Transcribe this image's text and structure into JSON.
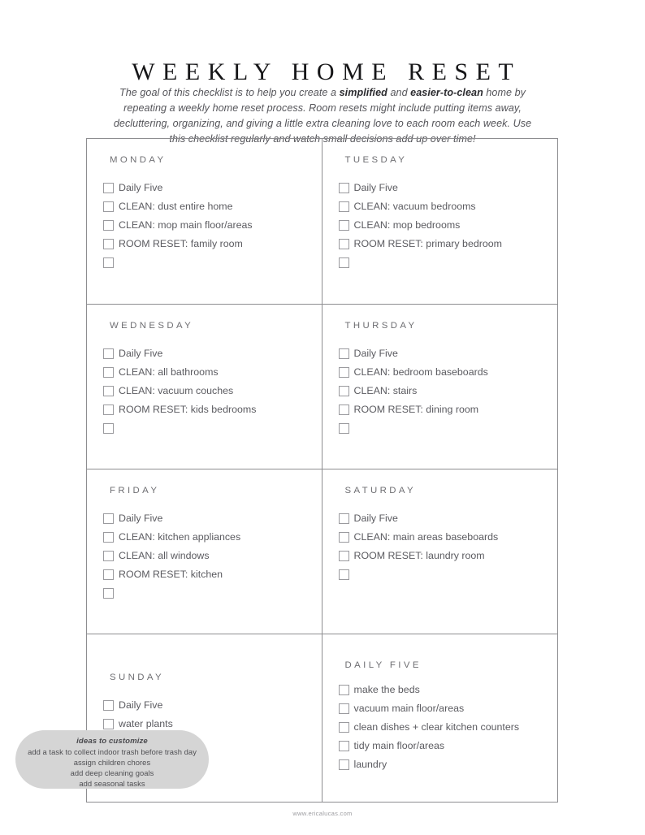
{
  "document": {
    "title": "WEEKLY HOME RESET",
    "intro_part1": "The goal of this checklist is to help you create a ",
    "intro_bold1": "simplified",
    "intro_part2": " and ",
    "intro_bold2": "easier-to-clean",
    "intro_part3": " home by repeating a weekly home reset process. Room resets might include putting items away, decluttering, organizing, and giving a little extra cleaning love to each room each week. Use this checklist regularly and watch small decisions add up over time!",
    "footer": "www.ericalucas.com"
  },
  "colors": {
    "border": "#8d8d90",
    "title_text": "#161618",
    "body_text": "#5b5b60",
    "bubble_bg": "#d5d5d5"
  },
  "sections": [
    {
      "key": "monday",
      "heading": "MONDAY",
      "tasks": [
        "Daily Five",
        "CLEAN: dust entire home",
        "CLEAN: mop main floor/areas",
        "ROOM RESET: family room",
        ""
      ]
    },
    {
      "key": "tuesday",
      "heading": "TUESDAY",
      "tasks": [
        "Daily Five",
        "CLEAN: vacuum bedrooms",
        "CLEAN: mop bedrooms",
        "ROOM RESET: primary bedroom",
        ""
      ]
    },
    {
      "key": "wednesday",
      "heading": "WEDNESDAY",
      "tasks": [
        "Daily Five",
        "CLEAN: all bathrooms",
        "CLEAN: vacuum couches",
        "ROOM RESET: kids bedrooms",
        ""
      ]
    },
    {
      "key": "thursday",
      "heading": "THURSDAY",
      "tasks": [
        "Daily Five",
        "CLEAN: bedroom baseboards",
        "CLEAN: stairs",
        "ROOM RESET: dining room",
        ""
      ]
    },
    {
      "key": "friday",
      "heading": "FRIDAY",
      "tasks": [
        "Daily Five",
        "CLEAN: kitchen appliances",
        "CLEAN: all windows",
        "ROOM RESET: kitchen",
        ""
      ]
    },
    {
      "key": "saturday",
      "heading": "SATURDAY",
      "tasks": [
        "Daily Five",
        "CLEAN: main areas baseboards",
        "ROOM RESET: laundry room",
        ""
      ]
    },
    {
      "key": "sunday",
      "heading": "SUNDAY",
      "tasks": [
        "Daily Five",
        "water plants"
      ]
    },
    {
      "key": "daily-five",
      "heading": "DAILY FIVE",
      "tasks": [
        "make the beds",
        "vacuum main floor/areas",
        "clean dishes + clear kitchen counters",
        "tidy main floor/areas",
        "laundry"
      ]
    }
  ],
  "ideas": {
    "title": "ideas to customize",
    "lines": [
      "add a task to collect indoor trash before trash day",
      "assign children chores",
      "add deep cleaning goals",
      "add seasonal tasks"
    ]
  }
}
